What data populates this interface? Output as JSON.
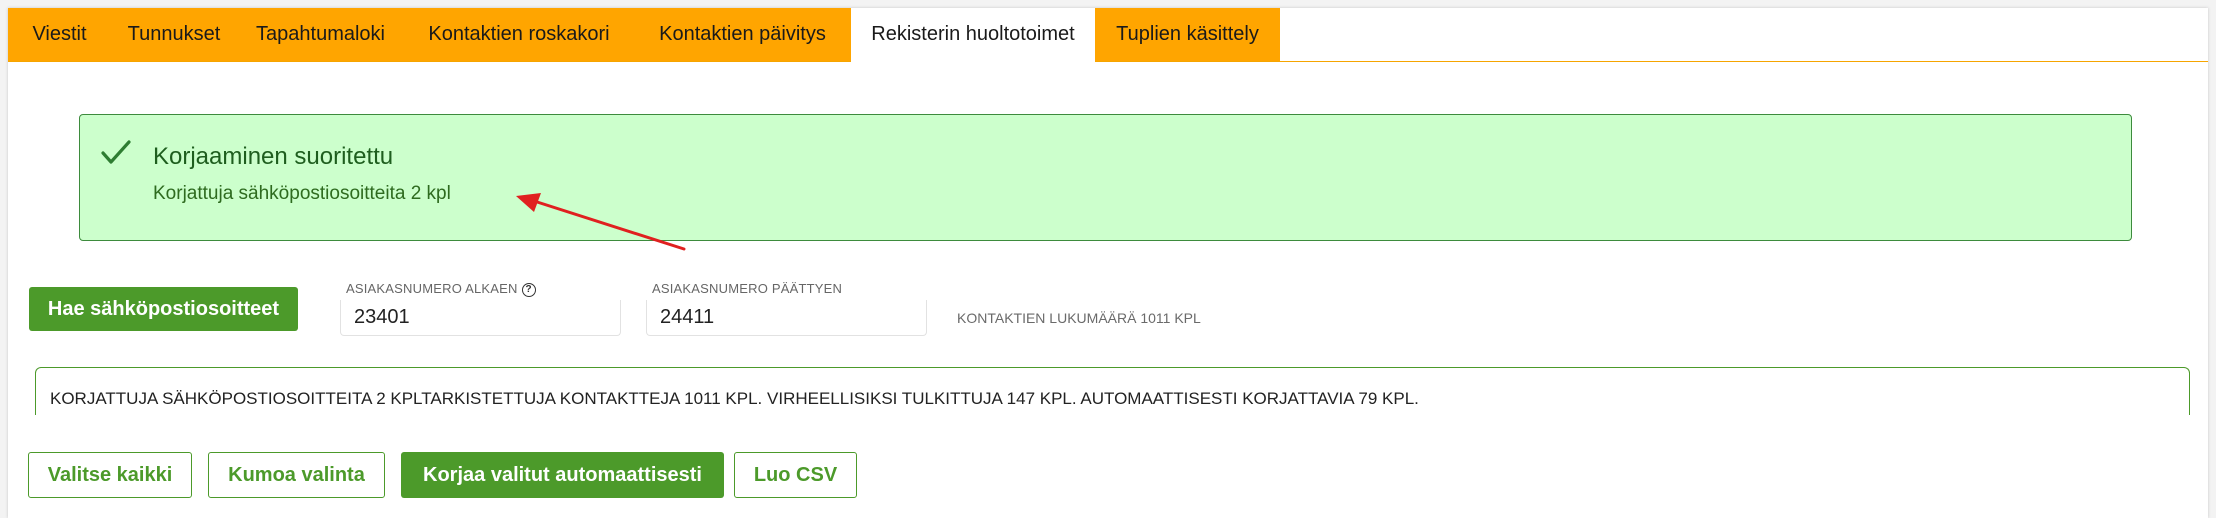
{
  "tabs": [
    {
      "label": "Viestit",
      "active": false
    },
    {
      "label": "Tunnukset",
      "active": false
    },
    {
      "label": "Tapahtumaloki",
      "active": false
    },
    {
      "label": "Kontaktien roskakori",
      "active": false
    },
    {
      "label": "Kontaktien päivitys",
      "active": false
    },
    {
      "label": "Rekisterin huoltotoimet",
      "active": true
    },
    {
      "label": "Tuplien käsittely",
      "active": false
    }
  ],
  "alert": {
    "title": "Korjaaminen suoritettu",
    "message": "Korjattuja sähköpostiosoitteita 2 kpl",
    "icon": "checkmark-icon"
  },
  "search": {
    "fetch_button_label": "Hae sähköpostiosoitteet",
    "start_label": "ASIAKASNUMERO ALKAEN",
    "start_value": "23401",
    "end_label": "ASIAKASNUMERO PÄÄTTYEN",
    "end_value": "24411",
    "contact_count_text": "KONTAKTIEN LUKUMÄÄRÄ 1011 KPL"
  },
  "summary": {
    "text": "KORJATTUJA SÄHKÖPOSTIOSOITTEITA 2 KPLTARKISTETTUJA KONTAKTTEJA 1011 KPL. VIRHEELLISIKSI TULKITTUJA 147 KPL. AUTOMAATTISESTI KORJATTAVIA 79 KPL."
  },
  "actions": {
    "select_all": "Valitse kaikki",
    "deselect": "Kumoa valinta",
    "fix_selected": "Korjaa valitut automaattisesti",
    "create_csv": "Luo CSV"
  },
  "colors": {
    "tab_bg": "#ffa500",
    "success_bg": "#ccffcc",
    "primary_green": "#4c9a2a",
    "annotation_arrow": "#e02020"
  }
}
